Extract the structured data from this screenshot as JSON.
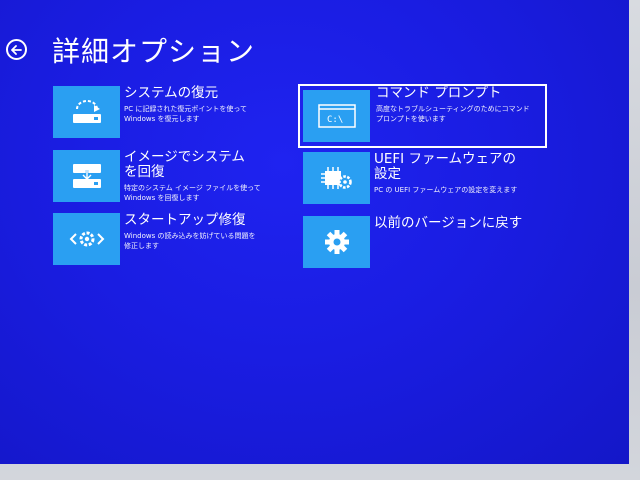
{
  "page": {
    "title": "詳細オプション",
    "background_color": "#1a1de2",
    "tile_color": "#2a9ff2"
  },
  "nav": {
    "back_icon": "back-arrow-icon"
  },
  "options": [
    {
      "id": "system-restore",
      "title": "システムの復元",
      "description_lines": [
        "PC に記録された復元ポイントを使って",
        "Windows を復元します"
      ],
      "icon": "system-restore-icon"
    },
    {
      "id": "system-image-recovery",
      "title": "イメージでシステムを回復",
      "description_lines": [
        "特定のシステム イメージ ファイルを使って",
        "Windows を回復します"
      ],
      "icon": "system-image-icon"
    },
    {
      "id": "startup-repair",
      "title": "スタートアップ修復",
      "description_lines": [
        "Windows の読み込みを妨げている問題を",
        "修正します"
      ],
      "icon": "startup-repair-icon"
    },
    {
      "id": "command-prompt",
      "title": "コマンド プロンプト",
      "description_lines": [
        "高度なトラブルシューティングのためにコマンド",
        "プロンプトを使います"
      ],
      "icon": "command-prompt-icon",
      "icon_text": "C:\\",
      "selected": true
    },
    {
      "id": "uefi-firmware-settings",
      "title": "UEFI ファームウェアの設定",
      "description_lines": [
        "PC の UEFI ファームウェアの設定を変えます"
      ],
      "icon": "firmware-chip-icon"
    },
    {
      "id": "go-back-previous-version",
      "title": "以前のバージョンに戻す",
      "description_lines": [],
      "icon": "gear-icon"
    }
  ]
}
